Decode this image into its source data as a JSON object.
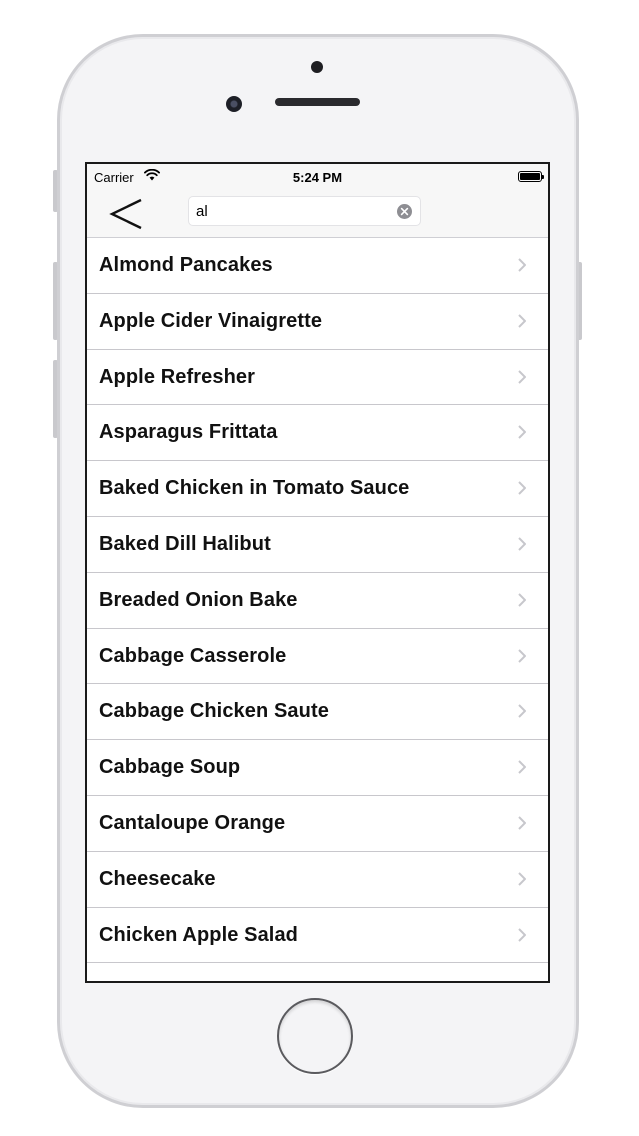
{
  "status_bar": {
    "carrier": "Carrier",
    "time": "5:24 PM",
    "wifi_icon": "wifi-icon",
    "battery_icon": "battery-icon"
  },
  "nav": {
    "back_icon": "chevron-left-icon",
    "search_value": "al",
    "clear_icon": "clear-circle-icon"
  },
  "recipes": [
    "Almond Pancakes",
    "Apple Cider Vinaigrette",
    "Apple Refresher",
    "Asparagus Frittata",
    "Baked Chicken in Tomato Sauce",
    "Baked Dill Halibut",
    "Breaded Onion Bake",
    "Cabbage Casserole",
    "Cabbage Chicken Saute",
    "Cabbage Soup",
    "Cantaloupe Orange",
    "Cheesecake",
    "Chicken Apple Salad"
  ],
  "colors": {
    "separator": "#c8c7cc",
    "chevron": "#c7c7cc",
    "bar_background": "#f7f7f7"
  }
}
